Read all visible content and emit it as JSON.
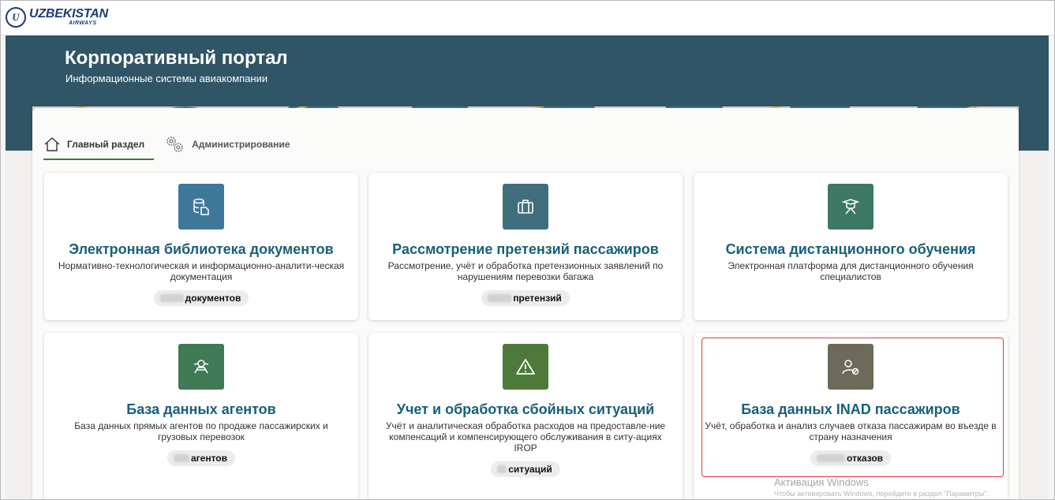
{
  "brand": {
    "logo_mark": "U",
    "name": "UZBEKISTAN",
    "sub": "AIRWAYS",
    "color": "#1d3b78"
  },
  "hero": {
    "title": "Корпоративный портал",
    "subtitle": "Информационные системы авиакомпании",
    "background": "#2f5566"
  },
  "tabs": [
    {
      "label": "Главный раздел",
      "icon": "home-icon",
      "active": true
    },
    {
      "label": "Администрирование",
      "icon": "gears-icon",
      "active": false
    }
  ],
  "cards": [
    {
      "title": "Электронная библиотека документов",
      "description": "Нормативно-технологическая и информационно-аналити-ческая документация",
      "badge_label": "документов",
      "icon": "database-document-icon",
      "icon_color": "#3e7898"
    },
    {
      "title": "Рассмотрение претензий пассажиров",
      "description": "Рассмотрение, учёт и обработка претензионных заявлений по нарушениям перевозки багажа",
      "badge_label": "претензий",
      "icon": "suitcase-icon",
      "icon_color": "#3f6f7e"
    },
    {
      "title": "Система дистанционного обучения",
      "description": "Электронная платформа для дистанционного обучения специалистов",
      "badge_label": null,
      "icon": "graduate-icon",
      "icon_color": "#3d7866"
    },
    {
      "title": "База данных агентов",
      "description": "База данных прямых агентов по продаже пассажирских и грузовых перевозок",
      "badge_label": "агентов",
      "icon": "agent-icon",
      "icon_color": "#3f7a55"
    },
    {
      "title": "Учет и обработка сбойных ситуаций",
      "description": "Учёт и аналитическая обработка расходов на предоставле-ние компенсаций и компенсирующего обслуживания в ситу-ациях IROP",
      "badge_label": "ситуаций",
      "icon": "warning-icon",
      "icon_color": "#4d7a3b"
    },
    {
      "title": "База данных INAD пассажиров",
      "description": "Учёт, обработка и анализ случаев отказа пассажирам во въезде в страну назначения",
      "badge_label": "отказов",
      "icon": "user-blocked-icon",
      "icon_color": "#6e6a59"
    }
  ],
  "watermark": {
    "title": "Активация Windows",
    "subtitle": "Чтобы активировать Windows, перейдите в раздел \"Параметры\"."
  },
  "colors": {
    "title_text": "#17607a",
    "tab_underline": "#3f7a35",
    "highlight": "#e03a3a"
  }
}
